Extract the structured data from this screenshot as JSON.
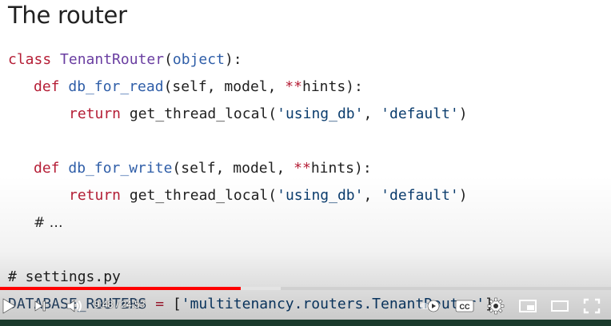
{
  "slide": {
    "title": "The router",
    "code": {
      "l1_kw": "class",
      "l1_name": "TenantRouter",
      "l1_open": "(",
      "l1_base": "object",
      "l1_close": "):",
      "l2_kw": "def",
      "l2_name": "db_for_read",
      "l2_args": "(self, model, ",
      "l2_op": "**",
      "l2_rest": "hints):",
      "l3_kw": "return",
      "l3_call": " get_thread_local(",
      "l3_s1": "'using_db'",
      "l3_sep": ", ",
      "l3_s2": "'default'",
      "l3_end": ")",
      "l5_kw": "def",
      "l5_name": "db_for_write",
      "l5_args": "(self, model, ",
      "l5_op": "**",
      "l5_rest": "hints):",
      "l6_kw": "return",
      "l6_call": " get_thread_local(",
      "l6_s1": "'using_db'",
      "l6_sep": ", ",
      "l6_s2": "'default'",
      "l6_end": ")",
      "l7_comment": "# …",
      "l9_comment": "# settings.py",
      "l10_name": "DATABASE_ROUTERS",
      "l10_eq": " = ",
      "l10_open": "[",
      "l10_str": "'multitenancy.routers.TenantRouter'",
      "l10_close": "]"
    }
  },
  "player": {
    "current_time": "9:48",
    "time_sep": " / ",
    "duration": "24:53",
    "progress_fraction": 0.394,
    "buffer_fraction": 0.46,
    "cc_label": "CC",
    "icons": {
      "play": "play-icon",
      "next": "next-icon",
      "volume": "volume-icon",
      "autoplay": "autoplay-toggle-icon",
      "cc": "captions-icon",
      "settings": "gear-icon",
      "miniplayer": "miniplayer-icon",
      "theater": "theater-mode-icon",
      "fullscreen": "fullscreen-icon"
    },
    "colors": {
      "progress": "#ff0000",
      "controls": "#ffffff"
    }
  }
}
